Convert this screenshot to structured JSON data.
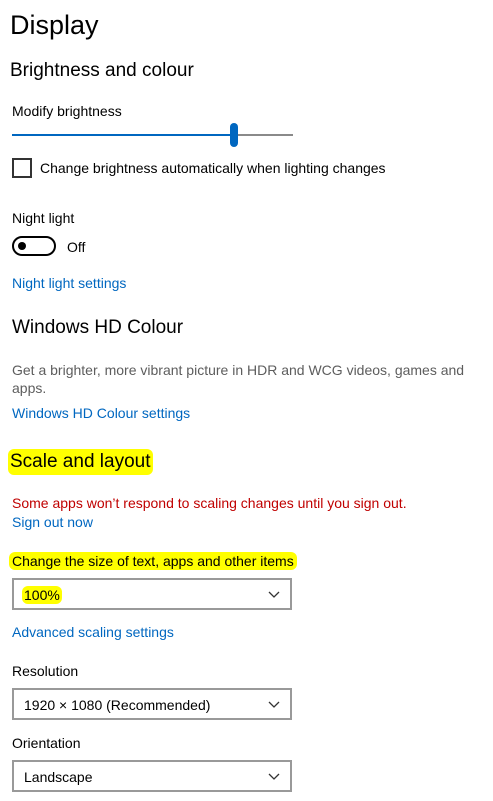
{
  "page": {
    "title": "Display"
  },
  "brightness": {
    "heading": "Brightness and colour",
    "slider_label": "Modify brightness",
    "level_fraction": 0.79,
    "auto_label": "Change brightness automatically when lighting changes",
    "auto_checked": false
  },
  "night_light": {
    "label": "Night light",
    "state": "Off",
    "settings_link": "Night light settings"
  },
  "hd_colour": {
    "heading": "Windows HD Colour",
    "description": "Get a brighter, more vibrant picture in HDR and WCG videos, games and apps.",
    "settings_link": "Windows HD Colour settings"
  },
  "scale_layout": {
    "heading": "Scale and layout",
    "warning": "Some apps won’t respond to scaling changes until you sign out.",
    "sign_out_link": "Sign out now",
    "size_label": "Change the size of text, apps and other items",
    "size_value": "100%",
    "advanced_link": "Advanced scaling settings",
    "resolution_label": "Resolution",
    "resolution_value": "1920 × 1080 (Recommended)",
    "orientation_label": "Orientation",
    "orientation_value": "Landscape"
  },
  "colors": {
    "accent": "#0067c0",
    "warning": "#c00000",
    "highlight": "#ffff00"
  }
}
